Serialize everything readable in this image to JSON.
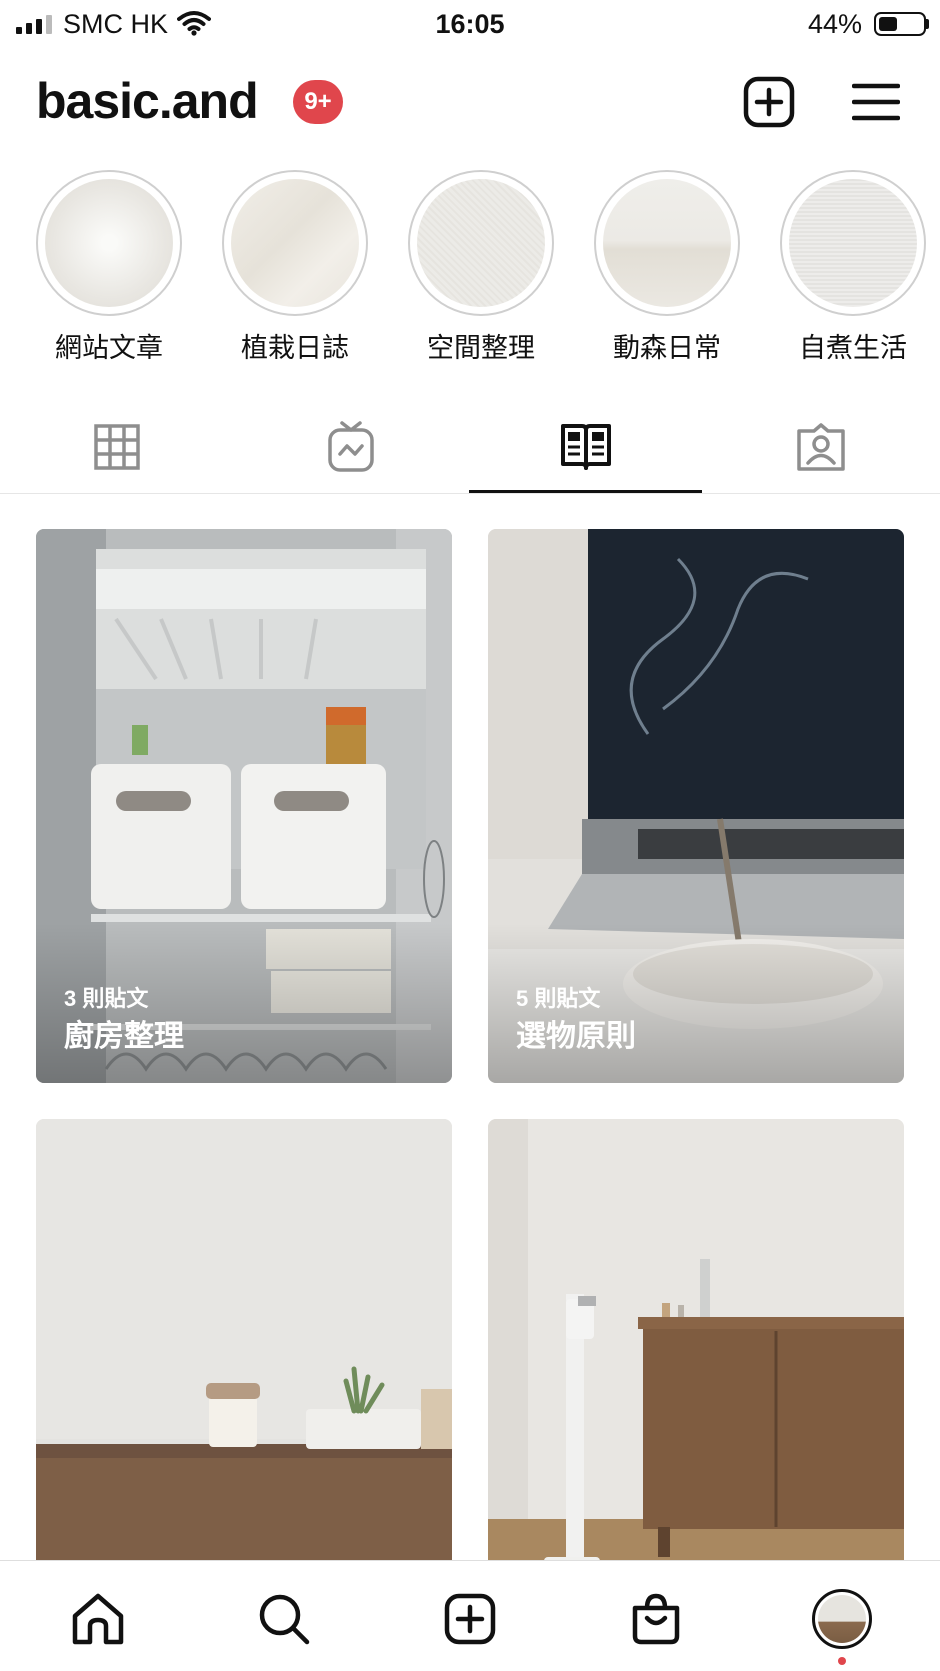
{
  "status_bar": {
    "carrier": "SMC HK",
    "time": "16:05",
    "battery_percent": "44%",
    "battery_level": 0.44
  },
  "header": {
    "username": "basic.and",
    "notification_badge": "9+",
    "new_post_icon": "plus-square-icon",
    "menu_icon": "hamburger-menu-icon"
  },
  "highlights": [
    {
      "label": "網站文章",
      "color": "#ebe9e4"
    },
    {
      "label": "植栽日誌",
      "color": "#eeebe4"
    },
    {
      "label": "空間整理",
      "color": "#ecebe7"
    },
    {
      "label": "動森日常",
      "color": "#ebeae6"
    },
    {
      "label": "自煮生活",
      "color": "#edecea"
    }
  ],
  "tabs": [
    {
      "name": "posts-grid",
      "icon": "grid-icon",
      "active": false
    },
    {
      "name": "igtv",
      "icon": "igtv-icon",
      "active": false
    },
    {
      "name": "guides",
      "icon": "guides-icon",
      "active": true
    },
    {
      "name": "tagged",
      "icon": "tagged-person-icon",
      "active": false
    }
  ],
  "guides": [
    {
      "count": "3 則貼文",
      "title": "廚房整理",
      "scene": "fridge"
    },
    {
      "count": "5 則貼文",
      "title": "選物原則",
      "scene": "laptop-incense"
    },
    {
      "count": "",
      "title": "",
      "scene": "desk-candle"
    },
    {
      "count": "",
      "title": "",
      "scene": "cabinet-vacuum"
    }
  ],
  "bottom_nav": [
    {
      "name": "home",
      "icon": "home-icon"
    },
    {
      "name": "search",
      "icon": "search-icon"
    },
    {
      "name": "create",
      "icon": "plus-square-icon"
    },
    {
      "name": "shop",
      "icon": "shopping-bag-icon"
    },
    {
      "name": "profile",
      "icon": "avatar"
    }
  ],
  "colors": {
    "badge": "#e0464c",
    "text": "#111111"
  }
}
